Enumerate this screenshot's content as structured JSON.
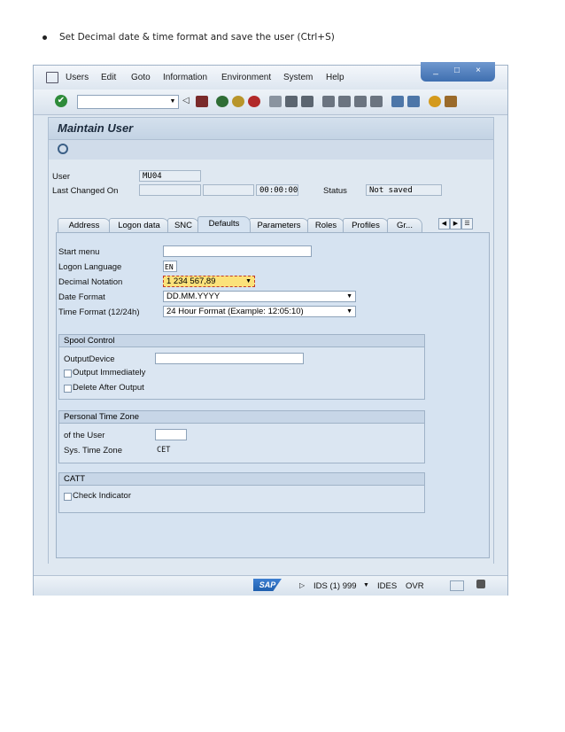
{
  "instruction": "Set Decimal date & time format and save the user (Ctrl+S)",
  "menu": [
    "Users",
    "Edit",
    "Goto",
    "Information",
    "Environment",
    "System",
    "Help"
  ],
  "window_controls": [
    "_",
    "□",
    "×"
  ],
  "title": "Maintain User",
  "fields": {
    "user_label": "User",
    "user_value": "MU04",
    "last_changed_label": "Last Changed On",
    "last_changed_time": "00:00:00",
    "status_label": "Status",
    "status_value": "Not saved"
  },
  "tabs": [
    "Address",
    "Logon data",
    "SNC",
    "Defaults",
    "Parameters",
    "Roles",
    "Profiles",
    "Gr..."
  ],
  "active_tab": "Defaults",
  "defaults": {
    "start_menu_label": "Start menu",
    "start_menu_value": "",
    "logon_language_label": "Logon Language",
    "logon_language_value": "EN",
    "decimal_notation_label": "Decimal Notation",
    "decimal_notation_value": "1 234 567,89",
    "date_format_label": "Date Format",
    "date_format_value": "DD.MM.YYYY",
    "time_format_label": "Time Format (12/24h)",
    "time_format_value": "24 Hour Format (Example: 12:05:10)"
  },
  "spool": {
    "title": "Spool Control",
    "output_device_label": "OutputDevice",
    "output_device_value": "",
    "output_immediately": "Output Immediately",
    "delete_after_output": "Delete After Output"
  },
  "timezone": {
    "title": "Personal Time Zone",
    "of_user_label": "of the User",
    "of_user_value": "",
    "sys_tz_label": "Sys. Time Zone",
    "sys_tz_value": "CET"
  },
  "catt": {
    "title": "CATT",
    "check_indicator": "Check Indicator"
  },
  "statusbar": {
    "logo": "SAP",
    "system": "IDS (1) 999",
    "server": "IDES",
    "mode": "OVR"
  },
  "colors": {
    "accent": "#3f6fb0",
    "highlight_field": "#fbe27a",
    "panel": "#d6e3f1"
  }
}
